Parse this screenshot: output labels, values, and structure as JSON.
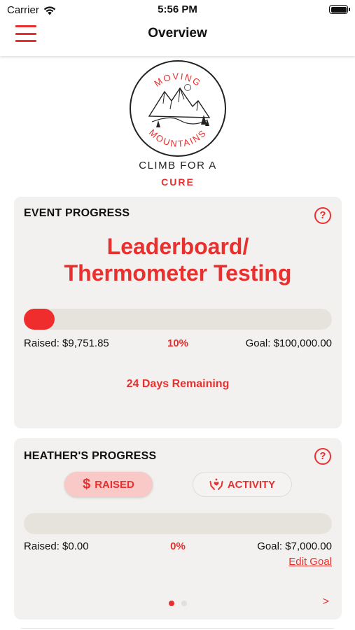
{
  "status_bar": {
    "carrier": "Carrier",
    "time": "5:56 PM",
    "icons": [
      "wifi-icon",
      "battery-icon"
    ]
  },
  "nav": {
    "title": "Overview",
    "menu_icon": "hamburger-menu-icon"
  },
  "logo": {
    "arc_top": "MOVING",
    "arc_bottom": "MOUNTAINS",
    "line1": "CLIMB FOR A",
    "line2": "CURE"
  },
  "event_progress": {
    "title": "EVENT PROGRESS",
    "help_label": "?",
    "event_name_line1": "Leaderboard/",
    "event_name_line2": "Thermometer Testing",
    "progress_fraction": 0.1,
    "raised": "Raised: $9,751.85",
    "percent": "10%",
    "goal": "Goal: $100,000.00",
    "days_remaining": "24 Days Remaining"
  },
  "personal_progress": {
    "title": "HEATHER'S PROGRESS",
    "help_label": "?",
    "tabs": [
      {
        "label": "RAISED",
        "icon": "dollar-icon",
        "selected": true
      },
      {
        "label": "ACTIVITY",
        "icon": "hands-heart-icon",
        "selected": false
      }
    ],
    "progress_fraction": 0,
    "raised": "Raised: $0.00",
    "percent": "0%",
    "goal": "Goal: $7,000.00",
    "edit_goal": "Edit Goal",
    "page_index": 0,
    "page_count": 2,
    "next_label": ">"
  },
  "colors": {
    "accent": "#e8302f",
    "card_bg": "#f2f1ef",
    "track": "#e6e3dc",
    "selected_pill": "#f8c9c7"
  }
}
